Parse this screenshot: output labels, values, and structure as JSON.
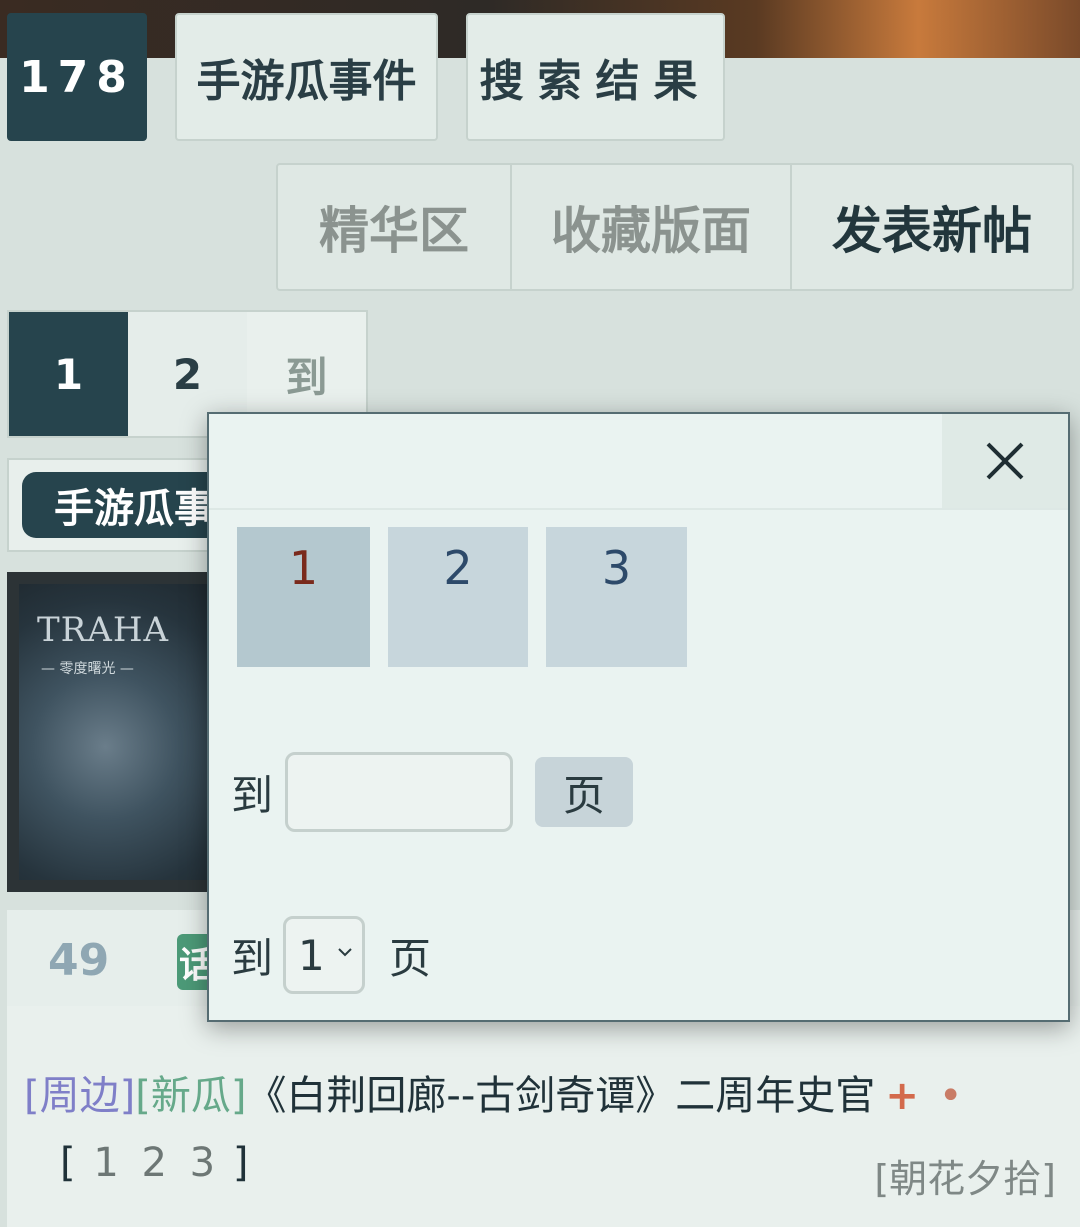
{
  "header": {
    "tabs": [
      {
        "label": "178"
      },
      {
        "label": "手游瓜事件"
      },
      {
        "label": "搜索结果"
      }
    ]
  },
  "actions": {
    "items": [
      {
        "label": "精华区"
      },
      {
        "label": "收藏版面"
      },
      {
        "label": "发表新帖"
      }
    ]
  },
  "pager": {
    "pages": [
      "1",
      "2"
    ],
    "goto_label": "到"
  },
  "breadcrumb": {
    "label": "手游瓜事件"
  },
  "banner": {
    "logo": "TRAHA",
    "subtitle": "— 零度曙光 —"
  },
  "post": {
    "count": "49",
    "badge": "话",
    "tag1": "[周边]",
    "tag2": "[新瓜]",
    "title": "《白荆回廊--古剑奇谭》二周年史官",
    "plus": "+",
    "dot": "•",
    "page_links": [
      "1",
      "2",
      "3"
    ],
    "author": "[朝花夕拾]"
  },
  "modal": {
    "page_tiles": [
      "1",
      "2",
      "3"
    ],
    "goto_prefix": "到",
    "input_placeholder": "",
    "go_button": "页",
    "select_prefix": "到",
    "select_value": "1",
    "select_suffix": "页"
  }
}
